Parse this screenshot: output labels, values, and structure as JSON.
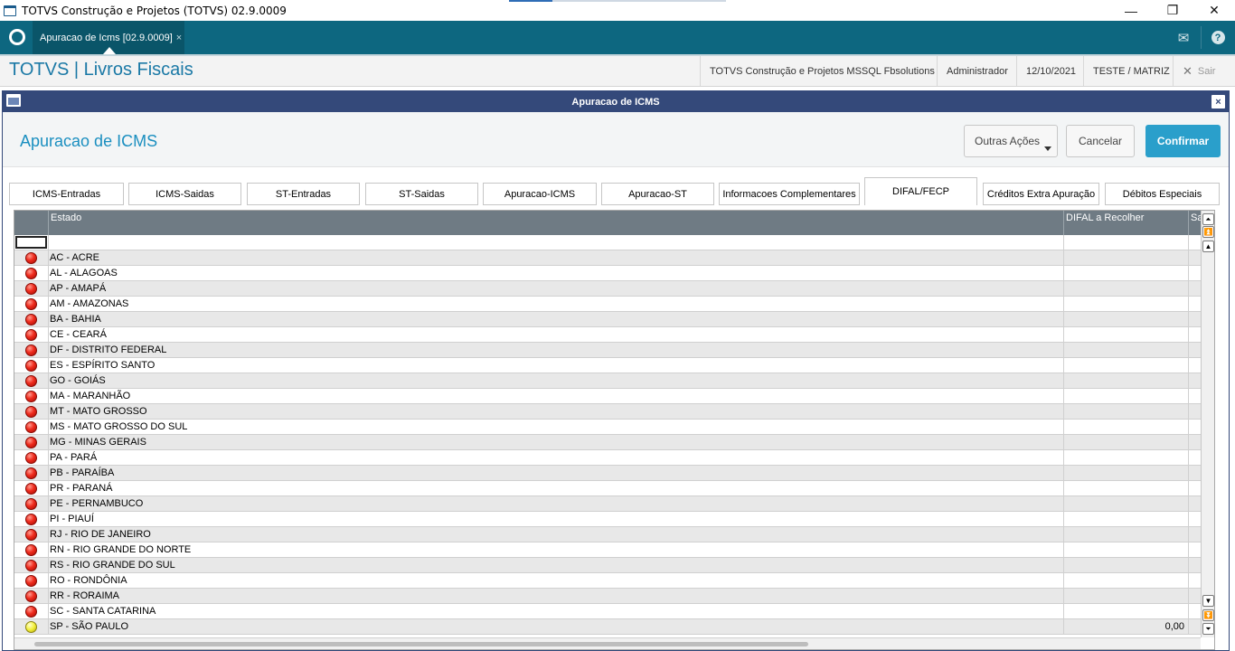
{
  "window": {
    "title": "TOTVS Construção e Projetos (TOTVS) 02.9.0009",
    "controls": [
      "—",
      "❐",
      "✕"
    ]
  },
  "appbar": {
    "tab_label": "Apuracao de Icms [02.9.0009]",
    "tab_close": "×",
    "mail_icon": "✉",
    "help_icon": "?"
  },
  "module": {
    "title": "TOTVS | Livros Fiscais",
    "company": "TOTVS Construção e Projetos MSSQL Fbsolutions",
    "user": "Administrador",
    "date": "12/10/2021",
    "branch": "TESTE / MATRIZ",
    "exit_label": "Sair",
    "exit_icon": "✕"
  },
  "dialog": {
    "title": "Apuracao de ICMS",
    "heading": "Apuracao de ICMS",
    "close": "×",
    "buttons": {
      "other_actions": "Outras Ações",
      "cancel": "Cancelar",
      "confirm": "Confirmar"
    },
    "tabs": [
      "ICMS-Entradas",
      "ICMS-Saidas",
      "ST-Entradas",
      "ST-Saidas",
      "Apuracao-ICMS",
      "Apuracao-ST",
      "Informacoes Complementares",
      "DIFAL/FECP",
      "Créditos Extra Apuração",
      "Débitos Especiais"
    ],
    "active_tab": "DIFAL/FECP"
  },
  "grid": {
    "columns": {
      "estado": "Estado",
      "difal": "DIFAL a Recolher",
      "next": "Sa"
    },
    "status_colors": {
      "red": "#ef2b1d",
      "yellow": "#f2ef3a"
    },
    "rows": [
      {
        "status": "red",
        "estado": "AC - ACRE",
        "difal": ""
      },
      {
        "status": "red",
        "estado": "AL - ALAGOAS",
        "difal": ""
      },
      {
        "status": "red",
        "estado": "AP - AMAPÁ",
        "difal": ""
      },
      {
        "status": "red",
        "estado": "AM - AMAZONAS",
        "difal": ""
      },
      {
        "status": "red",
        "estado": "BA - BAHIA",
        "difal": ""
      },
      {
        "status": "red",
        "estado": "CE - CEARÁ",
        "difal": ""
      },
      {
        "status": "red",
        "estado": "DF - DISTRITO FEDERAL",
        "difal": ""
      },
      {
        "status": "red",
        "estado": "ES - ESPÍRITO SANTO",
        "difal": ""
      },
      {
        "status": "red",
        "estado": "GO - GOIÁS",
        "difal": ""
      },
      {
        "status": "red",
        "estado": "MA - MARANHÃO",
        "difal": ""
      },
      {
        "status": "red",
        "estado": "MT - MATO GROSSO",
        "difal": ""
      },
      {
        "status": "red",
        "estado": "MS - MATO GROSSO DO SUL",
        "difal": ""
      },
      {
        "status": "red",
        "estado": "MG - MINAS GERAIS",
        "difal": ""
      },
      {
        "status": "red",
        "estado": "PA - PARÁ",
        "difal": ""
      },
      {
        "status": "red",
        "estado": "PB - PARAÍBA",
        "difal": ""
      },
      {
        "status": "red",
        "estado": "PR - PARANÁ",
        "difal": ""
      },
      {
        "status": "red",
        "estado": "PE - PERNAMBUCO",
        "difal": ""
      },
      {
        "status": "red",
        "estado": "PI - PIAUÍ",
        "difal": ""
      },
      {
        "status": "red",
        "estado": "RJ - RIO DE JANEIRO",
        "difal": ""
      },
      {
        "status": "red",
        "estado": "RN - RIO GRANDE DO NORTE",
        "difal": ""
      },
      {
        "status": "red",
        "estado": "RS - RIO GRANDE DO SUL",
        "difal": ""
      },
      {
        "status": "red",
        "estado": "RO - RONDÔNIA",
        "difal": ""
      },
      {
        "status": "red",
        "estado": "RR - RORAIMA",
        "difal": ""
      },
      {
        "status": "red",
        "estado": "SC - SANTA CATARINA",
        "difal": ""
      },
      {
        "status": "yellow",
        "estado": "SP - SÃO PAULO",
        "difal": "0,00"
      }
    ]
  }
}
